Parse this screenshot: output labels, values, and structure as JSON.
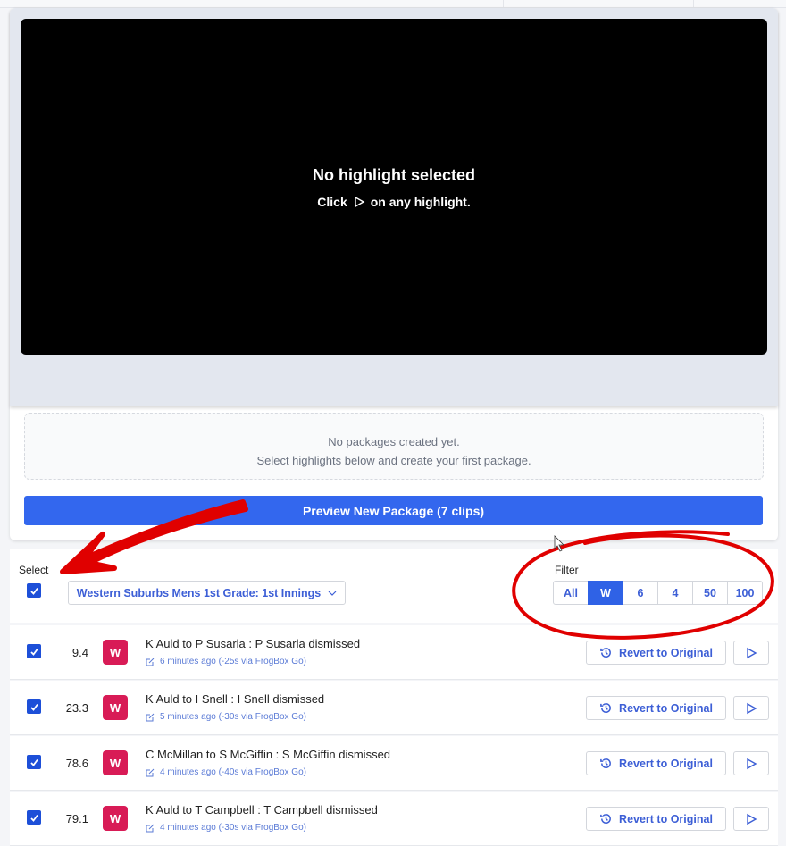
{
  "player": {
    "empty_title": "No highlight selected",
    "hint_before": "Click",
    "hint_after": "on any highlight."
  },
  "packages": {
    "empty_line1": "No packages created yet.",
    "empty_line2": "Select highlights below and create your first package.",
    "preview_button": "Preview New Package (7 clips)"
  },
  "list_header": {
    "select_label": "Select",
    "innings_dropdown": "Western Suburbs Mens 1st Grade: 1st Innings",
    "filter_label": "Filter",
    "filters": [
      "All",
      "W",
      "6",
      "4",
      "50",
      "100"
    ],
    "active_filter": "W"
  },
  "rows": [
    {
      "over": "9.4",
      "badge": "W",
      "title": "K Auld to P Susarla : P Susarla dismissed",
      "meta": "6 minutes ago (-25s via FrogBox Go)",
      "revert": "Revert to Original"
    },
    {
      "over": "23.3",
      "badge": "W",
      "title": "K Auld to I Snell : I Snell dismissed",
      "meta": "5 minutes ago (-30s via FrogBox Go)",
      "revert": "Revert to Original"
    },
    {
      "over": "78.6",
      "badge": "W",
      "title": "C McMillan to S McGiffin : S McGiffin dismissed",
      "meta": "4 minutes ago (-40s via FrogBox Go)",
      "revert": "Revert to Original"
    },
    {
      "over": "79.1",
      "badge": "W",
      "title": "K Auld to T Campbell : T Campbell dismissed",
      "meta": "4 minutes ago (-30s via FrogBox Go)",
      "revert": "Revert to Original"
    }
  ],
  "colors": {
    "accent": "#3367ee",
    "badge": "#d81b56",
    "annotation": "#e00000"
  }
}
